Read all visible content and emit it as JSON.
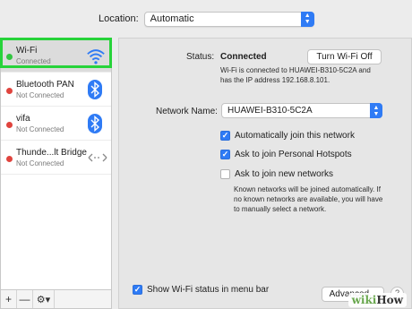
{
  "location": {
    "label": "Location:",
    "value": "Automatic"
  },
  "services": [
    {
      "name": "Wi-Fi",
      "status": "Connected",
      "dot": "#33c541",
      "icon": "wifi-icon"
    },
    {
      "name": "Bluetooth PAN",
      "status": "Not Connected",
      "dot": "#e0443e",
      "icon": "bluetooth-icon"
    },
    {
      "name": "vifa",
      "status": "Not Connected",
      "dot": "#e0443e",
      "icon": "bluetooth-icon"
    },
    {
      "name": "Thunde...lt Bridge",
      "status": "Not Connected",
      "dot": "#e0443e",
      "icon": "ethernet-icon"
    }
  ],
  "toolbar": {
    "add": "+",
    "remove": "—",
    "gear": "⚙▾"
  },
  "status": {
    "label": "Status:",
    "value": "Connected",
    "button": "Turn Wi-Fi Off",
    "desc_line1": "Wi-Fi is connected to HUAWEI-B310-5C2A and",
    "desc_line2": "has the IP address 192.168.8.101."
  },
  "network": {
    "label": "Network Name:",
    "value": "HUAWEI-B310-5C2A"
  },
  "options": {
    "auto_join": {
      "label": "Automatically join this network",
      "checked": true
    },
    "hotspots": {
      "label": "Ask to join Personal Hotspots",
      "checked": true
    },
    "new_networks": {
      "label": "Ask to join new networks",
      "checked": false
    },
    "note_line1": "Known networks will be joined automatically. If",
    "note_line2": "no known networks are available, you will have",
    "note_line3": "to manually select a network."
  },
  "menu_bar": {
    "label": "Show Wi-Fi status in menu bar",
    "checked": true
  },
  "advanced_label": "Advanced...",
  "help_label": "?",
  "watermark": {
    "wiki": "wiki",
    "how": "How"
  },
  "colors": {
    "accent": "#2f7bf5",
    "highlight": "#27d33a"
  }
}
